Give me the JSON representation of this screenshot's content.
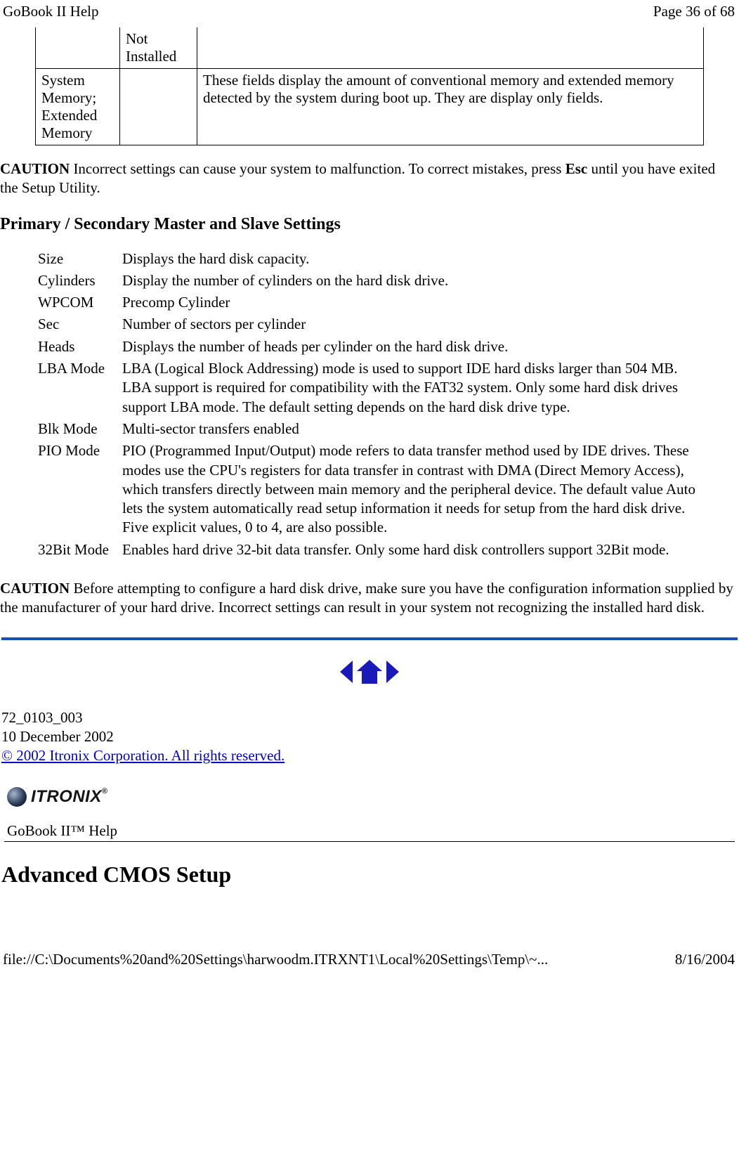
{
  "header": {
    "left": "GoBook II Help",
    "right": "Page 36 of 68"
  },
  "top_table": {
    "row1": {
      "c1": "",
      "c2": "Not Installed",
      "c3": ""
    },
    "row2": {
      "c1": "System Memory; Extended Memory",
      "c2": "",
      "c3": "These fields display the amount of conventional memory and extended memory detected by the system during boot up. They are display only fields."
    }
  },
  "caution1": {
    "label": "CAUTION",
    "text_part1": "  Incorrect settings can cause your system to malfunction.  To correct mistakes, press ",
    "esc": "Esc",
    "text_part2": " until you have exited the Setup Utility."
  },
  "section_heading": "Primary / Secondary Master and Slave Settings",
  "settings": [
    {
      "label": "Size",
      "desc": "Displays the hard disk capacity."
    },
    {
      "label": "Cylinders",
      "desc": "Display the number of cylinders on the hard disk drive."
    },
    {
      "label": "WPCOM",
      "desc": "Precomp Cylinder"
    },
    {
      "label": "Sec",
      "desc": "Number of sectors per cylinder"
    },
    {
      "label": "Heads",
      "desc": "Displays the number of heads per cylinder on the hard disk drive."
    },
    {
      "label": "LBA Mode",
      "desc": "LBA (Logical Block Addressing) mode is used to support IDE hard disks larger than 504 MB.  LBA support is required for compatibility with the FAT32 system.  Only some hard disk drives support LBA mode.  The default setting depends on the hard disk drive type."
    },
    {
      "label": "Blk Mode",
      "desc": "Multi-sector transfers enabled"
    },
    {
      "label": "PIO Mode",
      "desc": "PIO (Programmed Input/Output) mode refers to data transfer method used by IDE drives.  These modes use the CPU's registers for data transfer in contrast with DMA (Direct Memory Access), which transfers directly between main memory and the peripheral device.  The default value Auto lets the system automatically read setup information it needs for setup from the hard disk drive.  Five explicit values, 0 to 4, are also possible."
    },
    {
      "label": "32Bit Mode",
      "desc": "Enables hard drive 32-bit data transfer.  Only some hard disk controllers support 32Bit mode."
    }
  ],
  "caution2": {
    "label": "CAUTION",
    "text": "  Before attempting to configure a hard disk drive, make sure you have the configuration information supplied by the manufacturer of your hard drive.  Incorrect settings can result in your system not recognizing the installed hard disk."
  },
  "meta": {
    "doc_id": "72_0103_003",
    "date": "10 December 2002",
    "copyright": "© 2002 Itronix Corporation.  All rights reserved."
  },
  "logo_text": "ITRONIX",
  "help_label": "GoBook II™ Help",
  "main_heading": "Advanced CMOS Setup",
  "footer": {
    "left": "file://C:\\Documents%20and%20Settings\\harwoodm.ITRXNT1\\Local%20Settings\\Temp\\~...",
    "right": "8/16/2004"
  }
}
